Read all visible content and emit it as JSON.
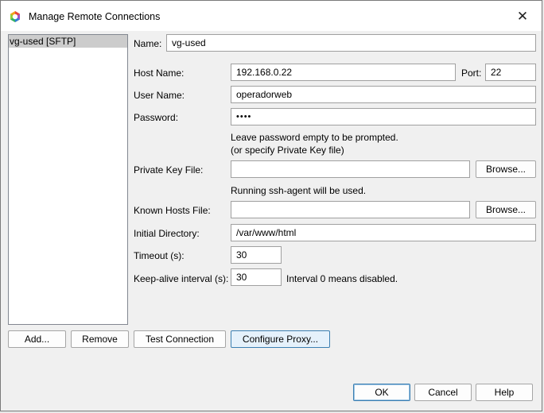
{
  "window": {
    "title": "Manage Remote Connections",
    "close_glyph": "✕"
  },
  "connections": {
    "items": [
      {
        "label": "vg-used [SFTP]",
        "selected": true
      }
    ]
  },
  "form": {
    "name_label": "Name:",
    "name_value": "vg-used",
    "host_label": "Host Name:",
    "host_value": "192.168.0.22",
    "port_label": "Port:",
    "port_value": "22",
    "user_label": "User Name:",
    "user_value": "operadorweb",
    "password_label": "Password:",
    "password_masked": "••••",
    "password_hint_1": "Leave password empty to be prompted.",
    "password_hint_2": "(or specify Private Key file)",
    "private_key_label": "Private Key File:",
    "private_key_value": "",
    "browse_label": "Browse...",
    "ssh_agent_note": "Running ssh-agent will be used.",
    "known_hosts_label": "Known Hosts File:",
    "known_hosts_value": "",
    "initial_dir_label": "Initial Directory:",
    "initial_dir_value": "/var/www/html",
    "timeout_label": "Timeout (s):",
    "timeout_value": "30",
    "keepalive_label": "Keep-alive interval (s):",
    "keepalive_value": "30",
    "keepalive_note": "Interval 0 means disabled."
  },
  "buttons": {
    "add": "Add...",
    "remove": "Remove",
    "test_connection": "Test Connection",
    "configure_proxy": "Configure Proxy...",
    "ok": "OK",
    "cancel": "Cancel",
    "help": "Help"
  },
  "colors": {
    "selection": "#cccccc",
    "accent": "#3c7fb1"
  }
}
